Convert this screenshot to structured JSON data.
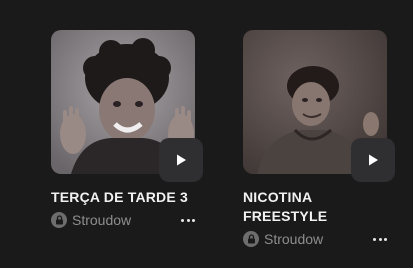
{
  "cards": [
    {
      "title": "TERÇA DE TARDE 3",
      "author": "Stroudow",
      "thumbnail_icon": "cover-photo-man-waving",
      "play_icon": "play-icon",
      "lock_icon": "lock-icon",
      "more_icon": "more-options-icon"
    },
    {
      "title_line1": "NICOTINA",
      "title_line2": "FREESTYLE",
      "author": "Stroudow",
      "thumbnail_icon": "cover-photo-man-dark",
      "play_icon": "play-icon",
      "lock_icon": "lock-icon",
      "more_icon": "more-options-icon"
    }
  ],
  "colors": {
    "background": "#1a1a1a",
    "title": "#f2f2f2",
    "author": "#8e8e8e",
    "play_button": "#2f2f31"
  }
}
